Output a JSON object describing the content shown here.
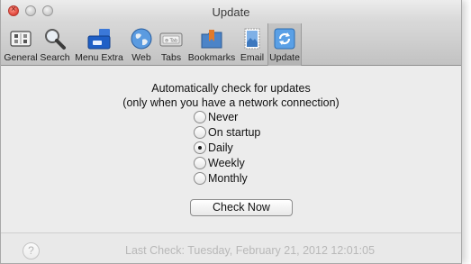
{
  "window": {
    "title": "Update"
  },
  "toolbar": {
    "items": [
      {
        "label": "General",
        "icon": "general-switches-icon"
      },
      {
        "label": "Search",
        "icon": "magnifier-icon"
      },
      {
        "label": "Menu Extra",
        "icon": "menu-extra-icon"
      },
      {
        "label": "Web",
        "icon": "globe-icon"
      },
      {
        "label": "Tabs",
        "icon": "tabs-icon"
      },
      {
        "label": "Bookmarks",
        "icon": "bookmarks-folder-icon"
      },
      {
        "label": "Email",
        "icon": "email-stamp-icon"
      },
      {
        "label": "Update",
        "icon": "update-arrows-icon",
        "selected": true
      }
    ]
  },
  "update": {
    "heading_line1": "Automatically check for updates",
    "heading_line2": "(only when you have a network connection)",
    "options": [
      {
        "label": "Never",
        "checked": false
      },
      {
        "label": "On startup",
        "checked": false
      },
      {
        "label": "Daily",
        "checked": true
      },
      {
        "label": "Weekly",
        "checked": false
      },
      {
        "label": "Monthly",
        "checked": false
      }
    ],
    "check_now_label": "Check Now"
  },
  "footer": {
    "help_label": "?",
    "last_check": "Last  Check:  Tuesday, February 21, 2012 12:01:05"
  },
  "colors": {
    "window_bg": "#ececec",
    "toolbar_bg": "#c8c8c8",
    "close_button": "#e0443a",
    "text": "#111111",
    "disabled_text": "#b8b8b8"
  }
}
